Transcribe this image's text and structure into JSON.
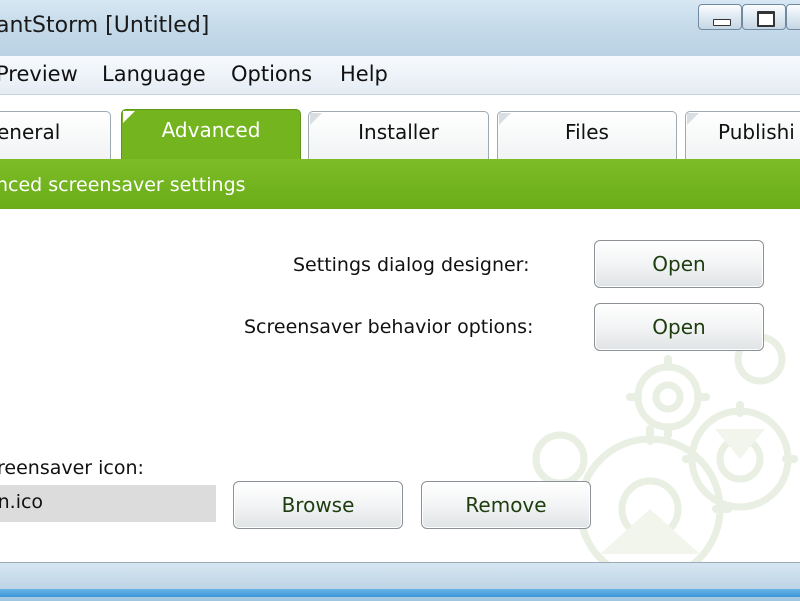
{
  "window": {
    "title": "antStorm [Untitled]"
  },
  "menu": [
    "Preview",
    "Language",
    "Options",
    "Help"
  ],
  "tabs": [
    "eneral",
    "Advanced",
    "Installer",
    "Files",
    "Publishi"
  ],
  "active_tab_index": 1,
  "section_header": "nced screensaver settings",
  "settings": {
    "dialog_designer_label": "Settings dialog designer:",
    "dialog_designer_button": "Open",
    "behavior_label": "Screensaver behavior options:",
    "behavior_button": "Open"
  },
  "icon": {
    "label": "reensaver icon:",
    "value": "on.ico",
    "browse_button": "Browse",
    "remove_button": "Remove"
  },
  "colors": {
    "accent_green": "#73b41f",
    "title_blue": "#c6dbea"
  }
}
